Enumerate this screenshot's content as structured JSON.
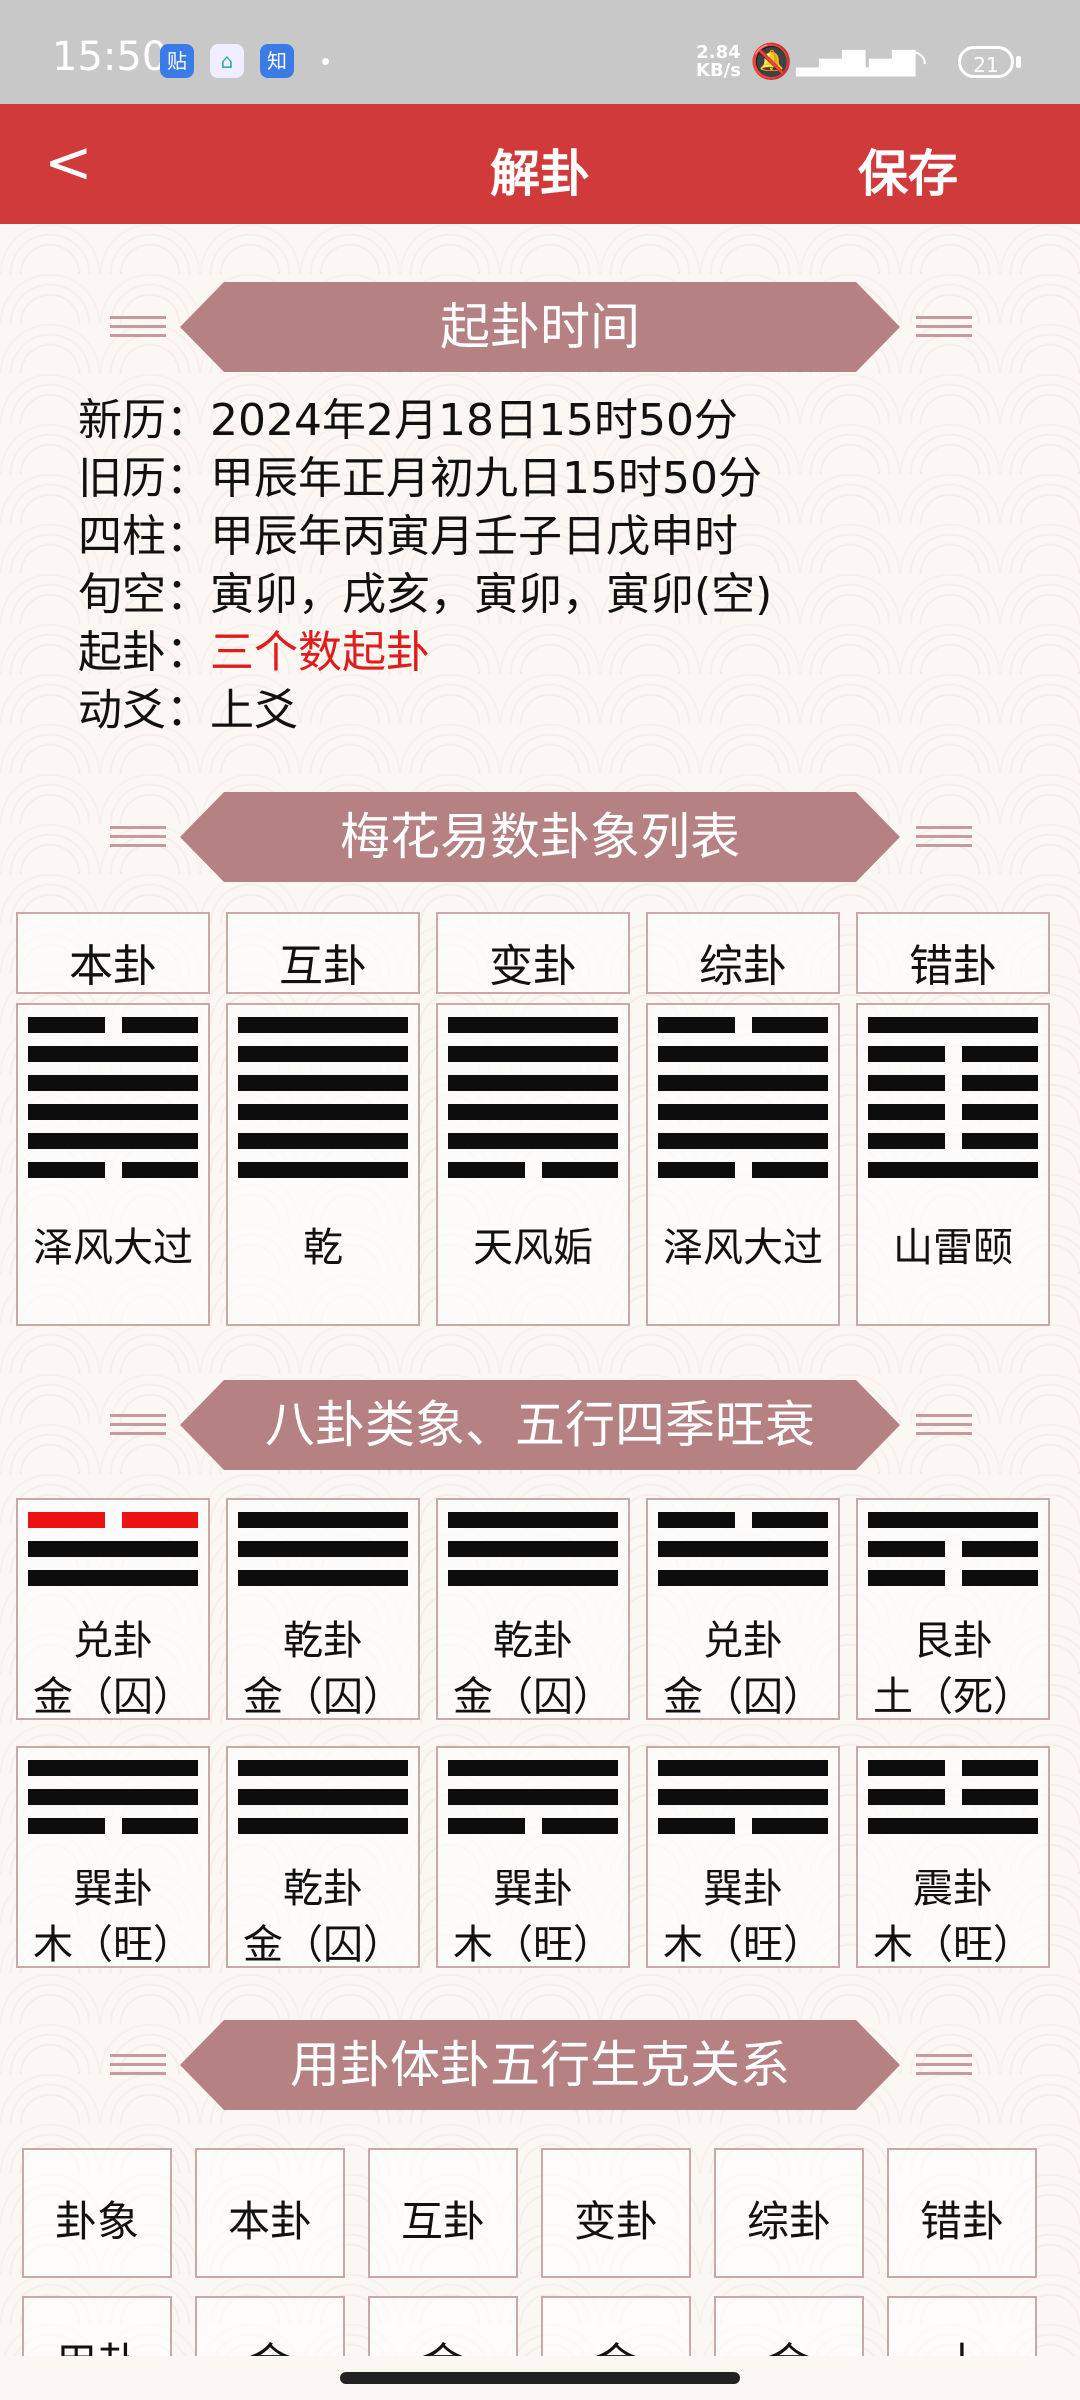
{
  "status": {
    "time": "15:50",
    "notif_icons": [
      "贴",
      "⌂",
      "知"
    ],
    "net_speed": "2.84",
    "net_unit": "KB/s",
    "battery": "21"
  },
  "header": {
    "title": "解卦",
    "save": "保存",
    "back": "<"
  },
  "section1": {
    "title": "起卦时间"
  },
  "info": [
    {
      "label": "新历：",
      "value": "2024年2月18日15时50分",
      "red": false
    },
    {
      "label": "旧历：",
      "value": "甲辰年正月初九日15时50分",
      "red": false
    },
    {
      "label": "四柱：",
      "value": "甲辰年丙寅月壬子日戊申时",
      "red": false
    },
    {
      "label": "旬空：",
      "value": "寅卯，戌亥，寅卯，寅卯(空)",
      "red": false
    },
    {
      "label": "起卦：",
      "value": "三个数起卦",
      "red": true
    },
    {
      "label": "动爻：",
      "value": "上爻",
      "red": false
    }
  ],
  "section2": {
    "title": "梅花易数卦象列表"
  },
  "gua_headers": [
    "本卦",
    "互卦",
    "变卦",
    "综卦",
    "错卦"
  ],
  "hexagrams": [
    {
      "name": "泽风大过",
      "lines": [
        "yin",
        "yang",
        "yang",
        "yang",
        "yang",
        "yin"
      ]
    },
    {
      "name": "乾",
      "lines": [
        "yang",
        "yang",
        "yang",
        "yang",
        "yang",
        "yang"
      ]
    },
    {
      "name": "天风姤",
      "lines": [
        "yang",
        "yang",
        "yang",
        "yang",
        "yang",
        "yin"
      ]
    },
    {
      "name": "泽风大过",
      "lines": [
        "yin",
        "yang",
        "yang",
        "yang",
        "yang",
        "yin"
      ]
    },
    {
      "name": "山雷颐",
      "lines": [
        "yang",
        "yin",
        "yin",
        "yin",
        "yin",
        "yang"
      ]
    }
  ],
  "section3": {
    "title": "八卦类象、五行四季旺衰"
  },
  "trigrams_row1": [
    {
      "name": "兑卦",
      "element": "金（囚）",
      "lines": [
        "yin",
        "yang",
        "yang"
      ],
      "red_top": true
    },
    {
      "name": "乾卦",
      "element": "金（囚）",
      "lines": [
        "yang",
        "yang",
        "yang"
      ],
      "red_top": false
    },
    {
      "name": "乾卦",
      "element": "金（囚）",
      "lines": [
        "yang",
        "yang",
        "yang"
      ],
      "red_top": false
    },
    {
      "name": "兑卦",
      "element": "金（囚）",
      "lines": [
        "yin",
        "yang",
        "yang"
      ],
      "red_top": false
    },
    {
      "name": "艮卦",
      "element": "土（死）",
      "lines": [
        "yang",
        "yin",
        "yin"
      ],
      "red_top": false
    }
  ],
  "trigrams_row2": [
    {
      "name": "巽卦",
      "element": "木（旺）",
      "lines": [
        "yang",
        "yang",
        "yin"
      ],
      "red_top": false
    },
    {
      "name": "乾卦",
      "element": "金（囚）",
      "lines": [
        "yang",
        "yang",
        "yang"
      ],
      "red_top": false
    },
    {
      "name": "巽卦",
      "element": "木（旺）",
      "lines": [
        "yang",
        "yang",
        "yin"
      ],
      "red_top": false
    },
    {
      "name": "巽卦",
      "element": "木（旺）",
      "lines": [
        "yang",
        "yang",
        "yin"
      ],
      "red_top": false
    },
    {
      "name": "震卦",
      "element": "木（旺）",
      "lines": [
        "yin",
        "yin",
        "yang"
      ],
      "red_top": false
    }
  ],
  "section4": {
    "title": "用卦体卦五行生克关系"
  },
  "relation_headers": [
    "卦象",
    "本卦",
    "互卦",
    "变卦",
    "综卦",
    "错卦"
  ],
  "relation_row2_partial": [
    "用卦",
    "金",
    "金",
    "金",
    "金",
    "土"
  ]
}
